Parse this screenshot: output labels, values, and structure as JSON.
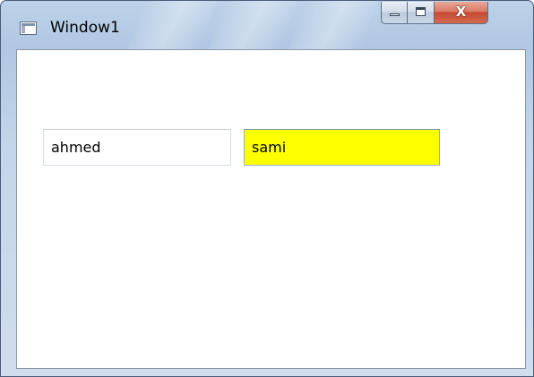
{
  "window": {
    "title": "Window1",
    "icons": {
      "app": "window-app-icon",
      "minimize": "minimize-icon",
      "maximize": "maximize-icon",
      "close": "close-icon"
    },
    "close_glyph": "X"
  },
  "fields": [
    {
      "value": "ahmed",
      "background": "#ffffff"
    },
    {
      "value": "sami",
      "background": "#ffff00"
    }
  ]
}
